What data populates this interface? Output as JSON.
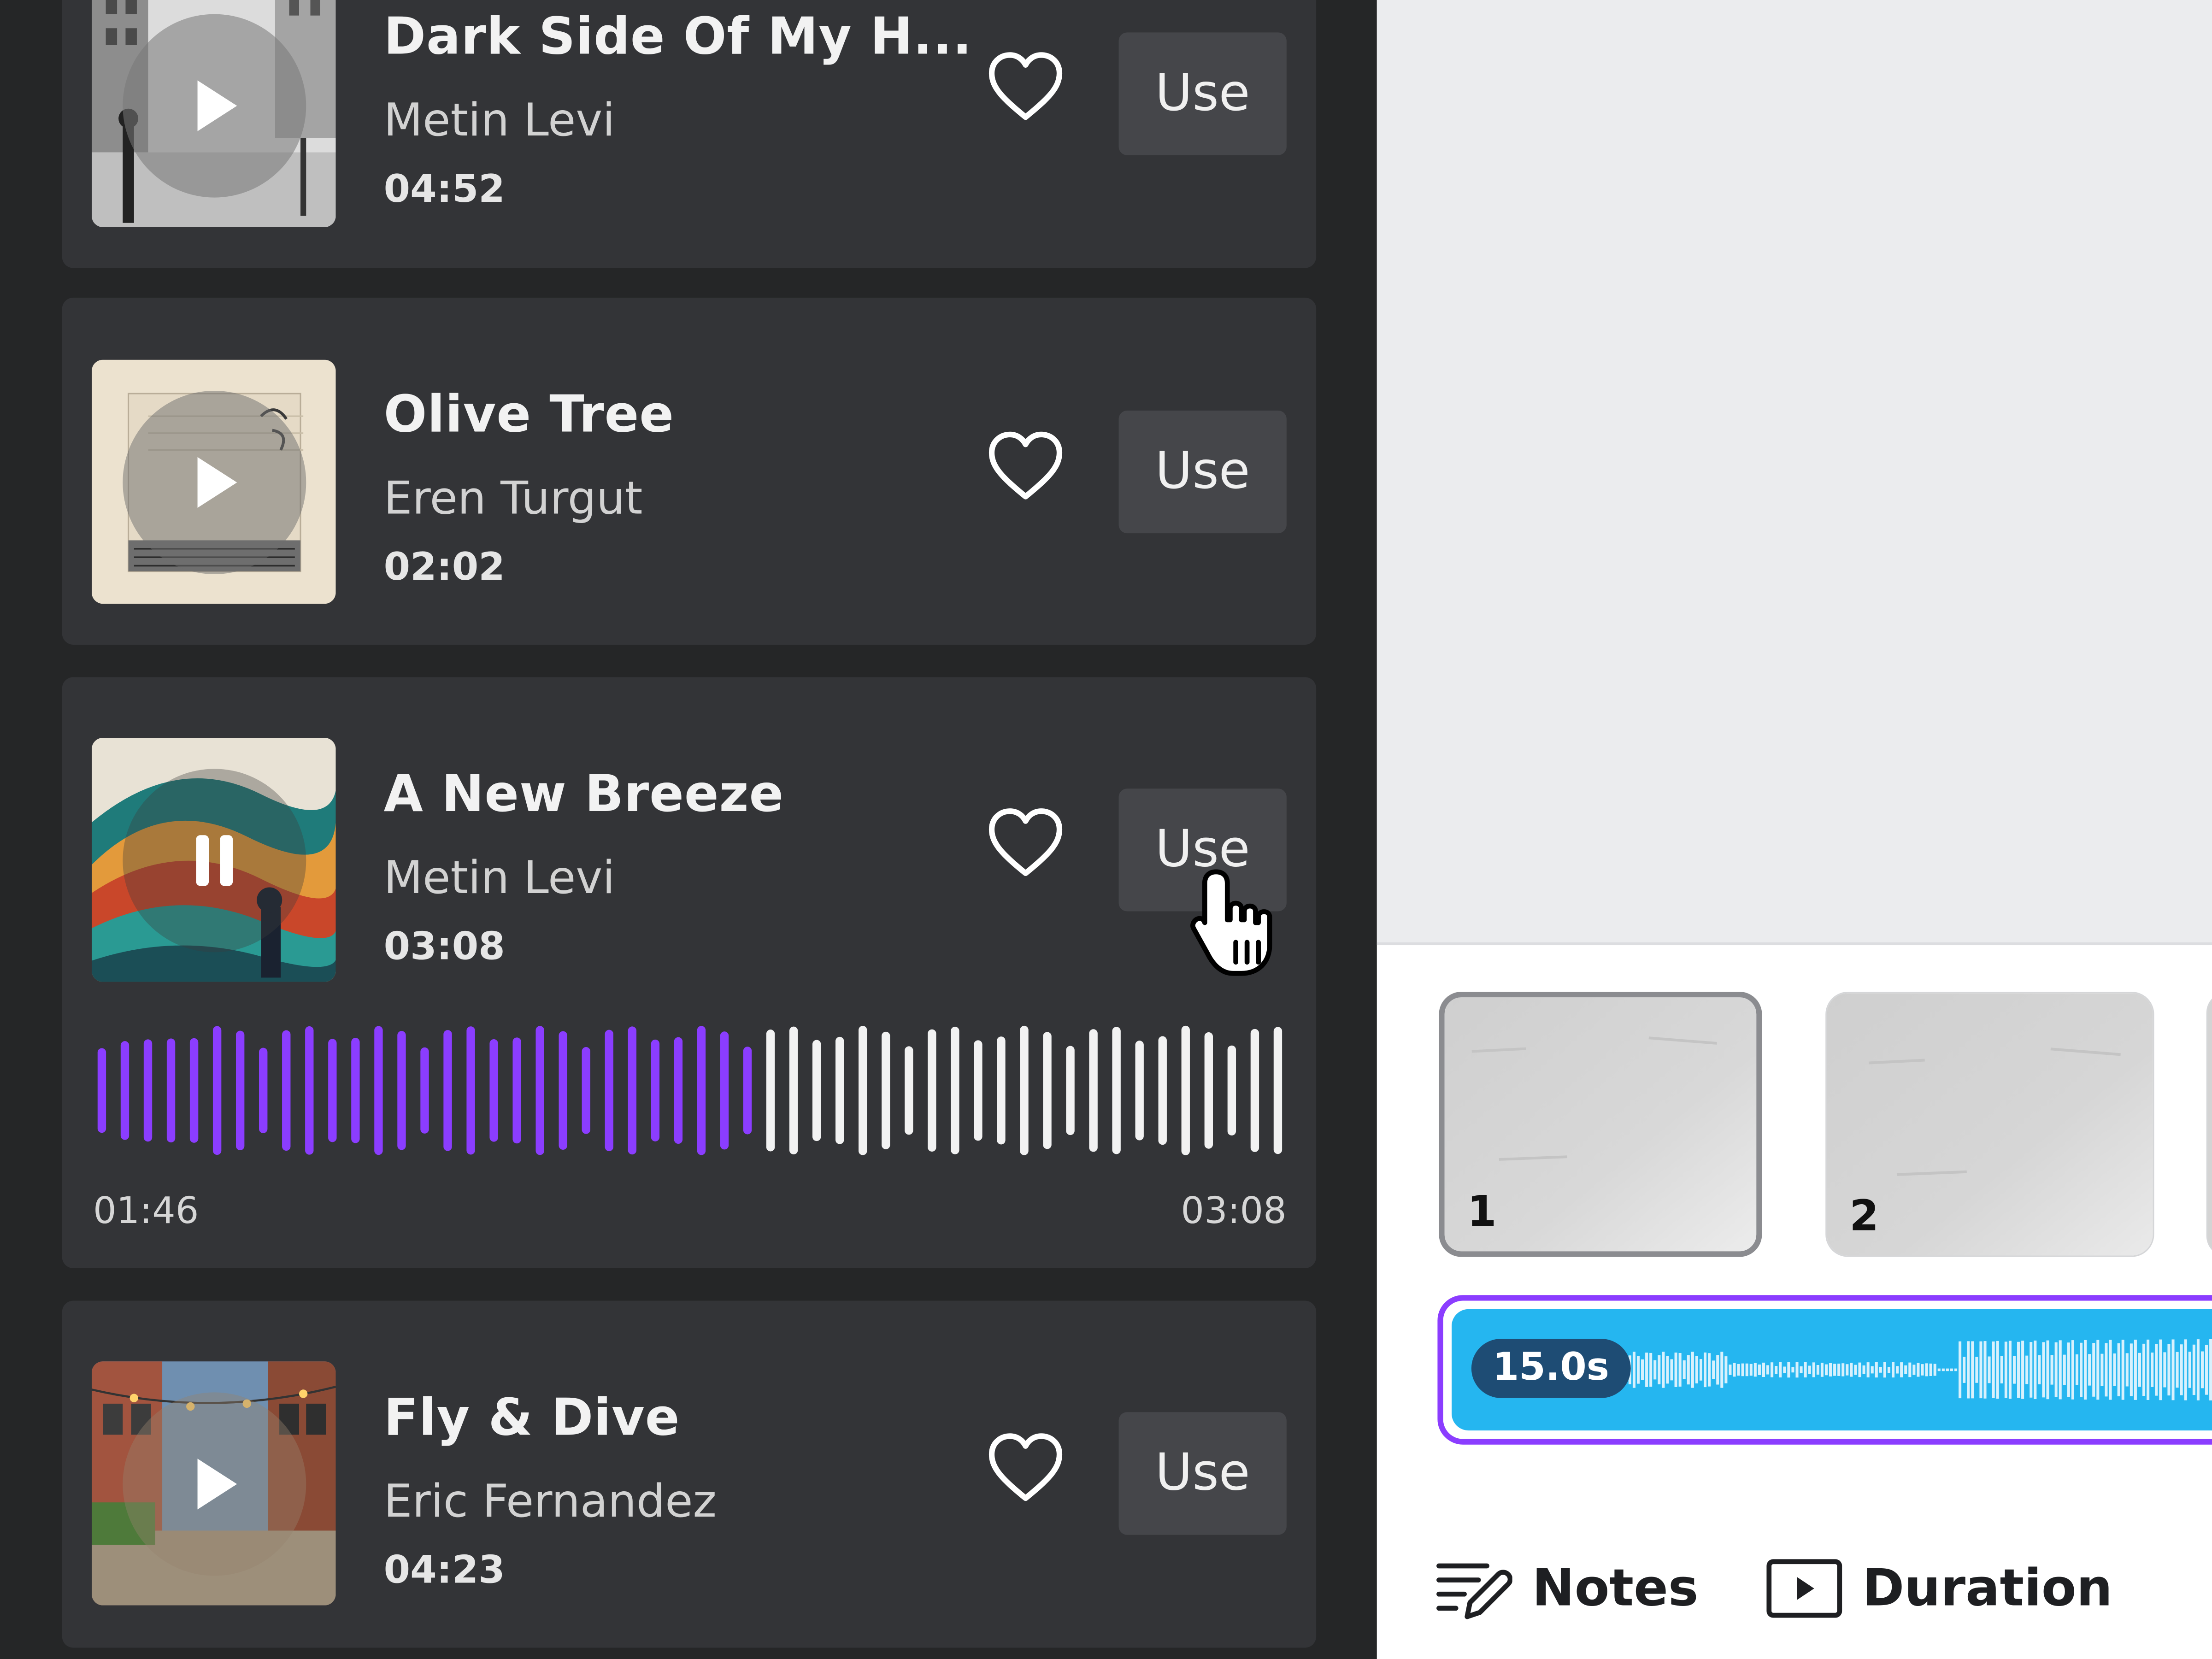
{
  "music_list": {
    "tracks": [
      {
        "title": "Dark Side Of My H...",
        "artist": "Metin Levi",
        "duration": "04:52",
        "use_label": "Use",
        "state": "paused"
      },
      {
        "title": "Olive Tree",
        "artist": "Eren Turgut",
        "duration": "02:02",
        "use_label": "Use",
        "state": "paused"
      },
      {
        "title": "A New Breeze",
        "artist": "Metin Levi",
        "duration": "03:08",
        "use_label": "Use",
        "state": "playing",
        "elapsed": "01:46",
        "total": "03:08",
        "progress": 0.564
      },
      {
        "title": "Fly & Dive",
        "artist": "Eric Fernandez",
        "duration": "04:23",
        "use_label": "Use",
        "state": "paused"
      }
    ],
    "colors": {
      "waveform_played": "#8b3dff",
      "waveform_remaining": "#f2f2f2"
    }
  },
  "timeline": {
    "pages": [
      {
        "number": "1",
        "selected": true
      },
      {
        "number": "2",
        "selected": false
      }
    ],
    "audio": {
      "duration_label": "15.0s",
      "color": "#25b6f0",
      "border_color": "#8b3dff"
    }
  },
  "footer": {
    "notes_label": "Notes",
    "duration_label": "Duration"
  }
}
